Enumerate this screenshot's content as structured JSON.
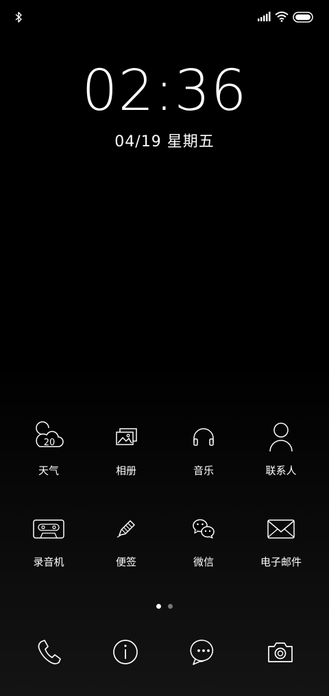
{
  "status_bar": {
    "left_icons": [
      "bluetooth-icon"
    ],
    "right_icons": [
      "signal-icon",
      "wifi-icon",
      "battery-icon"
    ]
  },
  "lockscreen": {
    "time": "02:36",
    "date": "04/19 星期五"
  },
  "apps": [
    {
      "name": "weather",
      "label": "天气",
      "icon": "weather-icon",
      "badge": "20"
    },
    {
      "name": "gallery",
      "label": "相册",
      "icon": "gallery-icon"
    },
    {
      "name": "music",
      "label": "音乐",
      "icon": "headphones-icon"
    },
    {
      "name": "contacts",
      "label": "联系人",
      "icon": "person-icon"
    },
    {
      "name": "recorder",
      "label": "录音机",
      "icon": "cassette-icon"
    },
    {
      "name": "notes",
      "label": "便签",
      "icon": "pencil-icon"
    },
    {
      "name": "wechat",
      "label": "微信",
      "icon": "wechat-icon"
    },
    {
      "name": "email",
      "label": "电子邮件",
      "icon": "envelope-icon"
    }
  ],
  "page_indicator": {
    "current": 1,
    "total": 2
  },
  "dock": [
    "phone-icon",
    "info-icon",
    "message-icon",
    "camera-icon"
  ],
  "colors": {
    "background": "#000000",
    "foreground": "#ffffff",
    "inactive_dot": "#777777"
  }
}
